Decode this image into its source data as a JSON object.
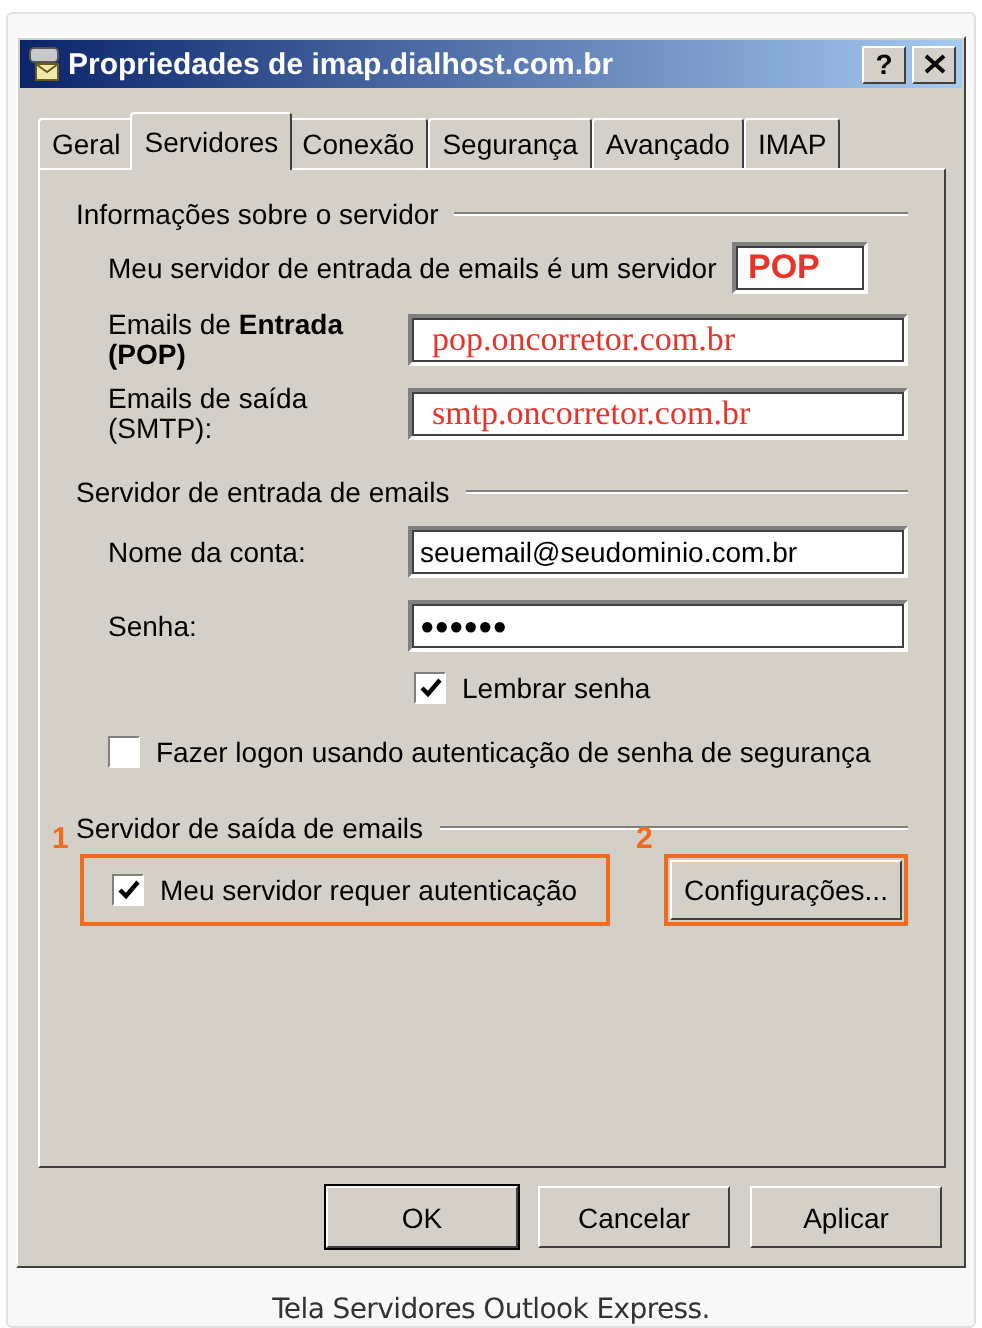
{
  "window": {
    "title": "Propriedades de imap.dialhost.com.br",
    "help": "?"
  },
  "tabs": [
    {
      "label": "Geral",
      "selected": false
    },
    {
      "label": "Servidores",
      "selected": true
    },
    {
      "label": "Conexão",
      "selected": false
    },
    {
      "label": "Segurança",
      "selected": false
    },
    {
      "label": "Avançado",
      "selected": false
    },
    {
      "label": "IMAP",
      "selected": false
    }
  ],
  "server_info": {
    "heading": "Informações sobre o servidor",
    "type_label": "Meu servidor de entrada de emails é um  servidor",
    "type_value": "POP",
    "fields": [
      {
        "lines": [
          "Emails de **Entrada**",
          "**(POP)**"
        ],
        "value": "pop.oncorretor.com.br",
        "highlight": true
      },
      {
        "lines": [
          "Emails de saída",
          "(SMTP):"
        ],
        "value": "smtp.oncorretor.com.br",
        "highlight": true
      }
    ]
  },
  "incoming": {
    "heading": "Servidor de entrada de emails",
    "fields": [
      {
        "label": "Nome da conta:",
        "value": "seuemail@seudominio.com.br",
        "kind": "text"
      },
      {
        "label": "Senha:",
        "value": "●●●●●●",
        "kind": "password"
      }
    ],
    "remember_password": {
      "label": "Lembrar senha",
      "checked": true
    },
    "secure_logon": {
      "label": "Fazer logon usando autenticação de senha de segurança",
      "checked": false
    }
  },
  "outgoing": {
    "heading": "Servidor de saída de emails",
    "checkbox": {
      "label": "Meu servidor requer autenticação",
      "checked": true,
      "callout": "1"
    },
    "button": {
      "label": "Configurações...",
      "callout": "2"
    }
  },
  "buttons": [
    {
      "label": "OK",
      "default": true
    },
    {
      "label": "Cancelar",
      "default": false
    },
    {
      "label": "Aplicar",
      "default": false
    }
  ],
  "caption": "Tela Servidores Outlook Express."
}
